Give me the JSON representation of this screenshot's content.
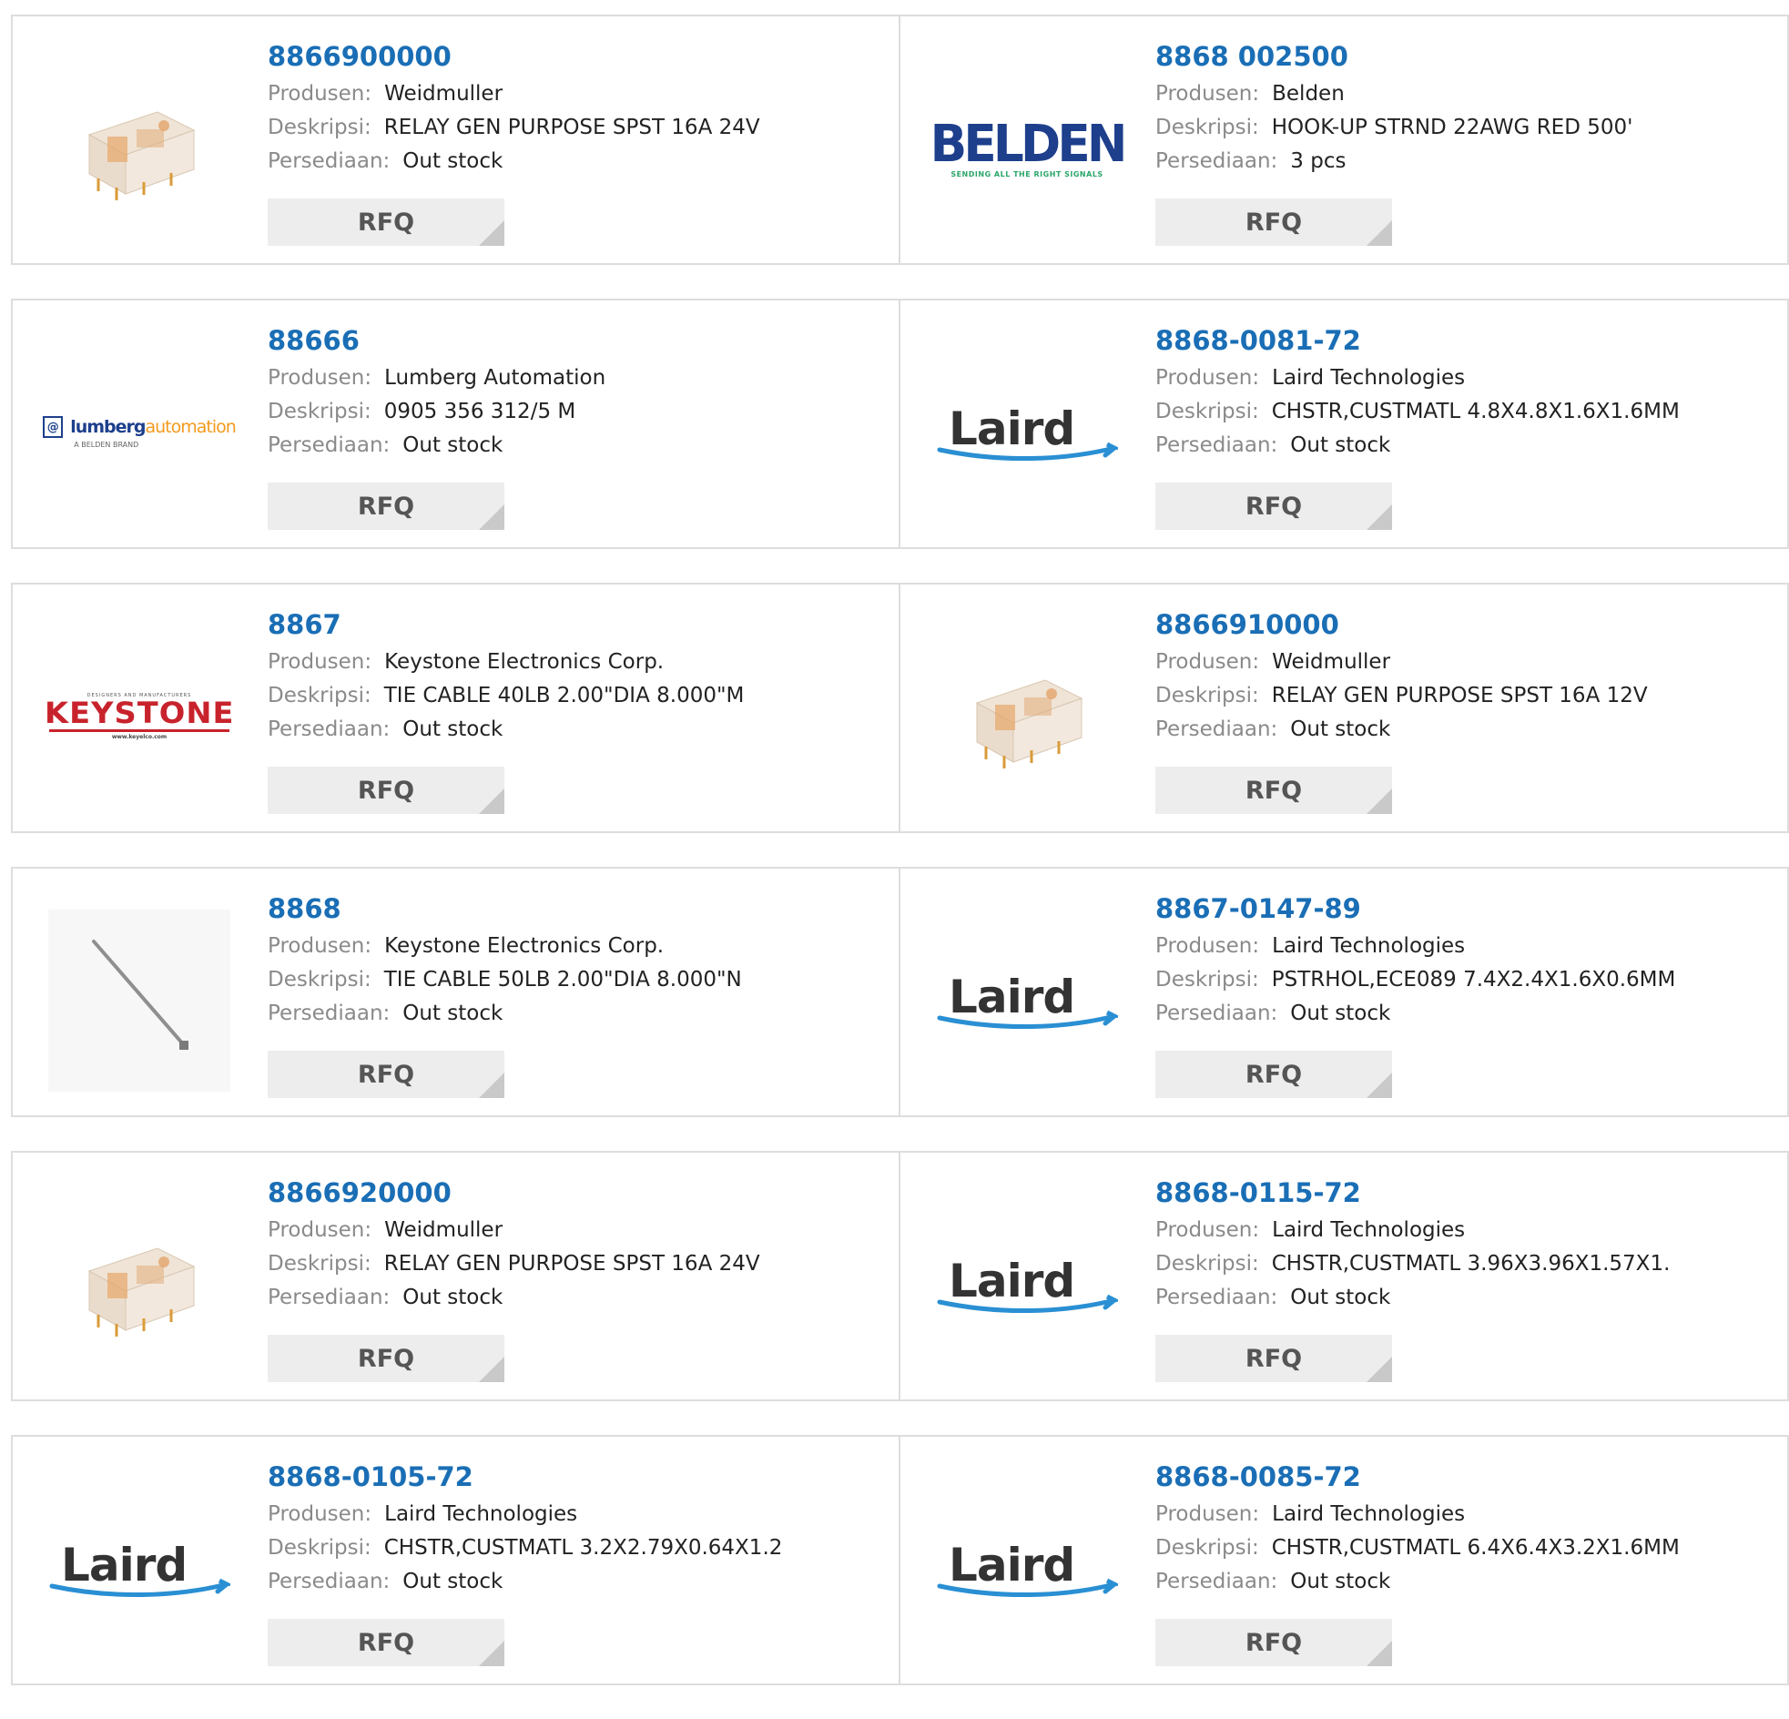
{
  "labels": {
    "manufacturer": "Produsen:",
    "description": "Deskripsi:",
    "stock": "Persediaan:",
    "rfq": "RFQ"
  },
  "products": [
    {
      "part": "8866900000",
      "manufacturer": "Weidmuller",
      "description": "RELAY GEN PURPOSE SPST 16A 24V",
      "stock": "Out stock",
      "image": "relay-image"
    },
    {
      "part": "8868 002500",
      "manufacturer": "Belden",
      "description": "HOOK-UP STRND 22AWG RED 500'",
      "stock": "3 pcs",
      "image": "belden-logo"
    },
    {
      "part": "88666",
      "manufacturer": "Lumberg Automation",
      "description": "0905 356 312/5 M",
      "stock": "Out stock",
      "image": "lumberg-logo"
    },
    {
      "part": "8868-0081-72",
      "manufacturer": "Laird Technologies",
      "description": "CHSTR,CUSTMATL 4.8X4.8X1.6X1.6MM",
      "stock": "Out stock",
      "image": "laird-logo"
    },
    {
      "part": "8867",
      "manufacturer": "Keystone Electronics Corp.",
      "description": "TIE CABLE 40LB 2.00\"DIA 8.000\"M",
      "stock": "Out stock",
      "image": "keystone-logo"
    },
    {
      "part": "8866910000",
      "manufacturer": "Weidmuller",
      "description": "RELAY GEN PURPOSE SPST 16A 12V",
      "stock": "Out stock",
      "image": "relay-image"
    },
    {
      "part": "8868",
      "manufacturer": "Keystone Electronics Corp.",
      "description": "TIE CABLE 50LB 2.00\"DIA 8.000\"N",
      "stock": "Out stock",
      "image": "cable-tie-image"
    },
    {
      "part": "8867-0147-89",
      "manufacturer": "Laird Technologies",
      "description": "PSTRHOL,ECE089 7.4X2.4X1.6X0.6MM",
      "stock": "Out stock",
      "image": "laird-logo"
    },
    {
      "part": "8866920000",
      "manufacturer": "Weidmuller",
      "description": "RELAY GEN PURPOSE SPST 16A 24V",
      "stock": "Out stock",
      "image": "relay-image"
    },
    {
      "part": "8868-0115-72",
      "manufacturer": "Laird Technologies",
      "description": "CHSTR,CUSTMATL 3.96X3.96X1.57X1.",
      "stock": "Out stock",
      "image": "laird-logo"
    },
    {
      "part": "8868-0105-72",
      "manufacturer": "Laird Technologies",
      "description": "CHSTR,CUSTMATL 3.2X2.79X0.64X1.2",
      "stock": "Out stock",
      "image": "laird-logo"
    },
    {
      "part": "8868-0085-72",
      "manufacturer": "Laird Technologies",
      "description": "CHSTR,CUSTMATL 6.4X6.4X3.2X1.6MM",
      "stock": "Out stock",
      "image": "laird-logo"
    }
  ],
  "logos": {
    "belden": {
      "word": "BELDEN",
      "tagline": "SENDING ALL THE RIGHT SIGNALS"
    },
    "laird": {
      "word": "Laird"
    },
    "lumberg": {
      "mark": "@",
      "word1": "lumberg",
      "word2": "automation",
      "sub": "A BELDEN BRAND"
    },
    "keystone": {
      "tiny": "DESIGNERS AND MANUFACTURERS",
      "word": "KEYSTONE",
      "url": "www.keyelco.com"
    }
  },
  "colors": {
    "link": "#1a6eb5",
    "button": "#ededed",
    "border": "#dddddd"
  }
}
